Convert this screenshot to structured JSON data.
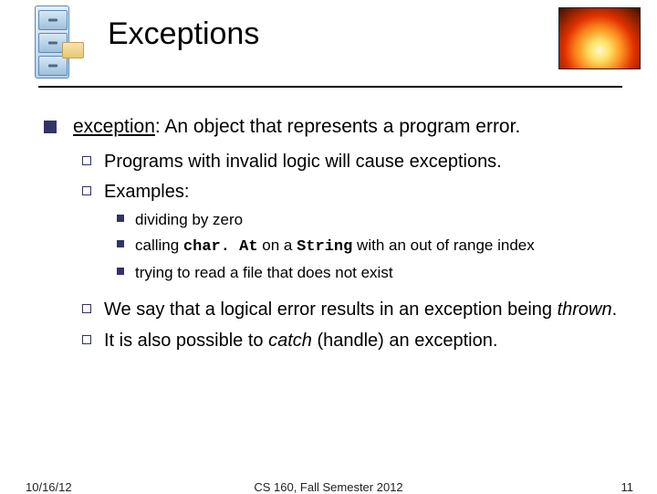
{
  "title": "Exceptions",
  "main": {
    "term": "exception",
    "def_rest": ": An object that represents a program error."
  },
  "sub1": "Programs with invalid logic will cause exceptions.",
  "sub2": "Examples:",
  "ex1": "dividing by zero",
  "ex2_pre": "calling ",
  "ex2_code1": "char. At",
  "ex2_mid": " on a ",
  "ex2_code2": "String",
  "ex2_post": " with an out of range index",
  "ex3": "trying to read a file that does not exist",
  "sub3_pre": "We say that a logical error results in an exception being ",
  "sub3_italic": "thrown",
  "sub3_post": ".",
  "sub4_pre": "It is also possible to ",
  "sub4_italic": "catch",
  "sub4_post": " (handle) an exception.",
  "footer": {
    "date": "10/16/12",
    "center": "CS 160, Fall Semester 2012",
    "page": "11"
  }
}
